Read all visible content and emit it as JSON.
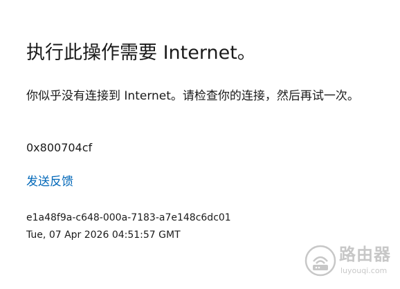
{
  "error_page": {
    "title": "执行此操作需要 Internet。",
    "message": "你似乎没有连接到 Internet。请检查你的连接，然后再试一次。",
    "error_code": "0x800704cf",
    "feedback_label": "发送反馈",
    "correlation_id": "e1a48f9a-c648-000a-7183-a7e148c6dc01",
    "timestamp": "Tue, 07 Apr 2026 04:51:57 GMT"
  },
  "watermark": {
    "name": "路由器",
    "url": "luyouqi.com",
    "logo_icon": "router-logo-icon"
  },
  "colors": {
    "background": "#ffffff",
    "text": "#1a1a1a",
    "link": "#0067b8",
    "watermark": "#9a9a9a"
  }
}
